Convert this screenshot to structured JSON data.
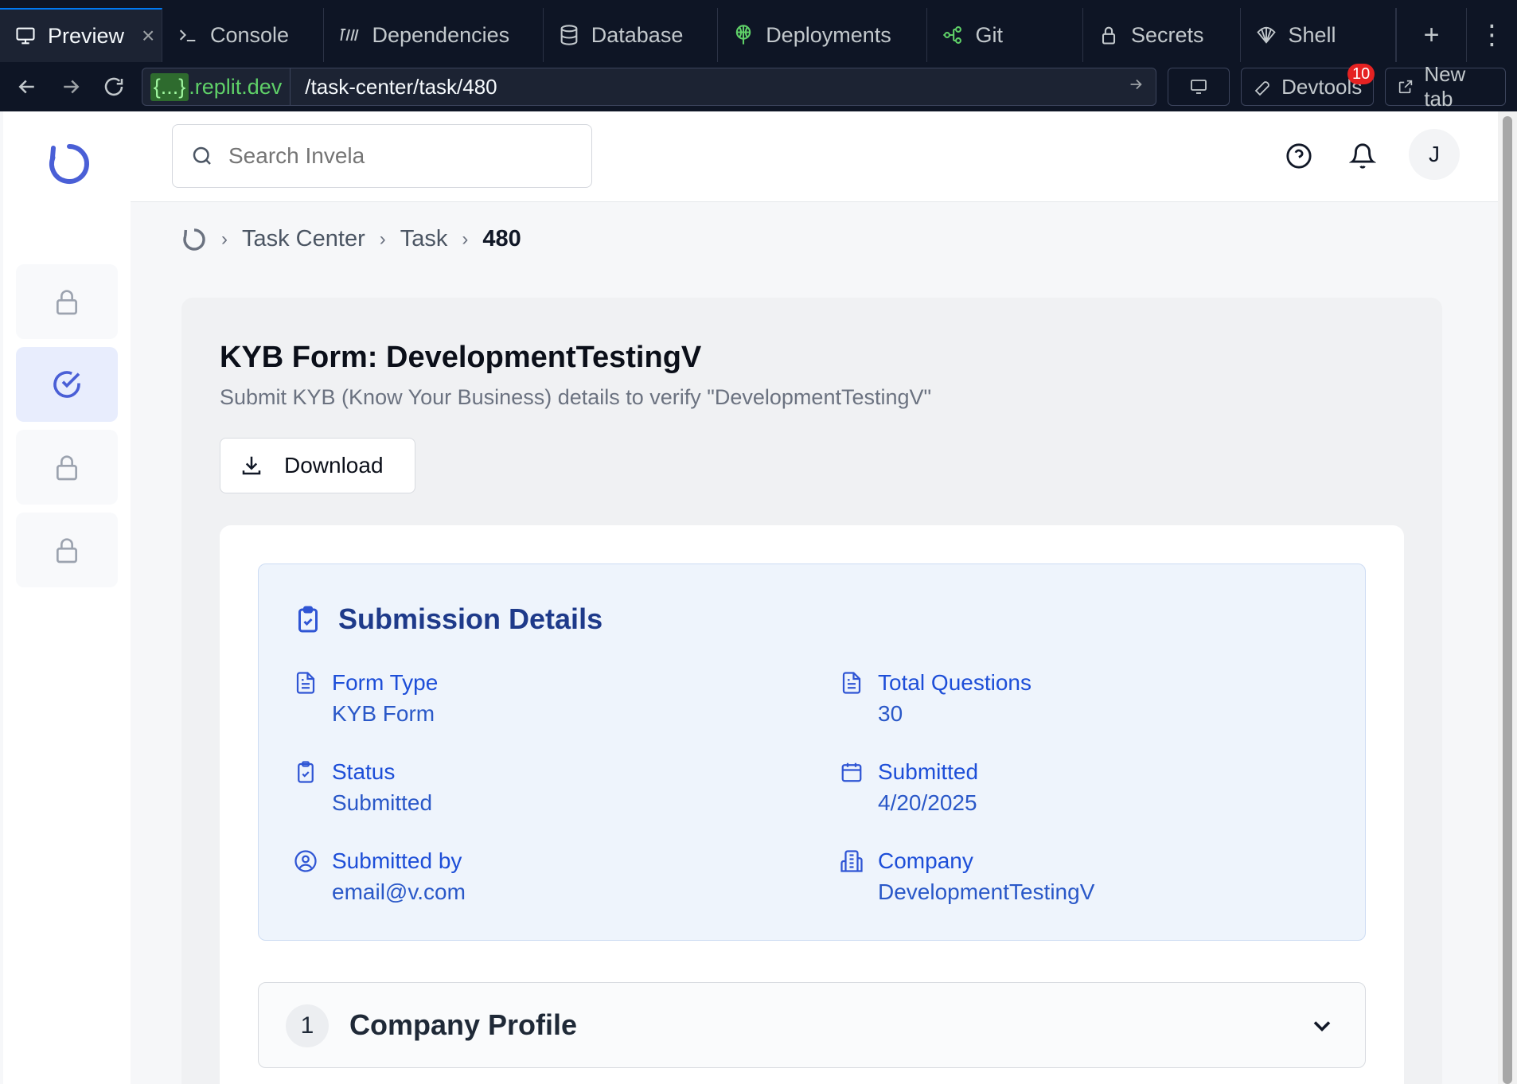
{
  "replit": {
    "tabs": [
      {
        "label": "Preview",
        "icon": "monitor-icon",
        "active": true
      },
      {
        "label": "Console",
        "icon": "terminal-icon"
      },
      {
        "label": "Dependencies",
        "icon": "dependencies-icon"
      },
      {
        "label": "Database",
        "icon": "database-icon"
      },
      {
        "label": "Deployments",
        "icon": "deployments-icon"
      },
      {
        "label": "Git",
        "icon": "git-icon"
      },
      {
        "label": "Secrets",
        "icon": "lock-icon"
      },
      {
        "label": "Shell",
        "icon": "shell-icon"
      }
    ],
    "close_symbol": "×",
    "add_symbol": "+",
    "more_symbol": "⋮",
    "url_host_brace": "{...}",
    "url_host_domain": ".replit.dev",
    "url_path": "/task-center/task/480",
    "devtools_label": "Devtools",
    "devtools_badge": "10",
    "newtab_label": "New tab"
  },
  "search": {
    "placeholder": "Search Invela"
  },
  "user": {
    "initial": "J"
  },
  "breadcrumb": {
    "items": [
      "Task Center",
      "Task"
    ],
    "current": "480"
  },
  "page": {
    "title": "KYB Form: DevelopmentTestingV",
    "subtitle": "Submit KYB (Know Your Business) details to verify \"DevelopmentTestingV\"",
    "download_label": "Download"
  },
  "details": {
    "heading": "Submission Details",
    "fields": [
      {
        "label": "Form Type",
        "value": "KYB Form",
        "icon": "document-icon"
      },
      {
        "label": "Total Questions",
        "value": "30",
        "icon": "document-icon"
      },
      {
        "label": "Status",
        "value": "Submitted",
        "icon": "clipboard-check-icon"
      },
      {
        "label": "Submitted",
        "value": "4/20/2025",
        "icon": "calendar-icon"
      },
      {
        "label": "Submitted by",
        "value": "email@v.com",
        "icon": "user-circle-icon"
      },
      {
        "label": "Company",
        "value": "DevelopmentTestingV",
        "icon": "building-icon"
      }
    ]
  },
  "section": {
    "number": "1",
    "title": "Company Profile"
  },
  "colors": {
    "accent": "#4a5fd6",
    "details_bg": "#eef4fc",
    "label_blue": "#1d4ed8"
  }
}
